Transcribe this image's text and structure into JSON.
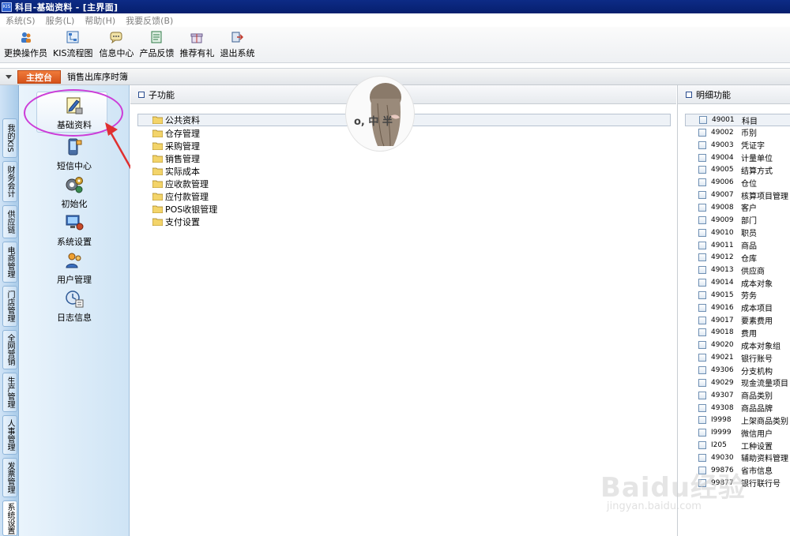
{
  "window": {
    "logo_text": "KIS",
    "title": "科目-基础资料 - [主界面]"
  },
  "menubar": [
    "系统(S)",
    "服务(L)",
    "帮助(H)",
    "我要反馈(B)"
  ],
  "toolbar": [
    "更换操作员",
    "KIS流程图",
    "信息中心",
    "产品反馈",
    "推荐有礼",
    "退出系统"
  ],
  "tabs": {
    "main": "主控台",
    "other": "销售出库序时簿"
  },
  "side_tabs": [
    "我的KIS",
    "财务会计",
    "供应链",
    "电商管理",
    "门店管理",
    "全网营销",
    "生产管理",
    "人事管理",
    "发票管理",
    "系统设置"
  ],
  "modules": [
    "基础资料",
    "短信中心",
    "初始化",
    "系统设置",
    "用户管理",
    "日志信息"
  ],
  "sub_pane": {
    "title": "子功能",
    "items": [
      "公共资料",
      "仓存管理",
      "采购管理",
      "销售管理",
      "实际成本",
      "应收款管理",
      "应付款管理",
      "POS收银管理",
      "支付设置"
    ]
  },
  "detail_pane": {
    "title": "明细功能",
    "items": [
      {
        "code": "49001",
        "name": "科目"
      },
      {
        "code": "49002",
        "name": "币别"
      },
      {
        "code": "49003",
        "name": "凭证字"
      },
      {
        "code": "49004",
        "name": "计量单位"
      },
      {
        "code": "49005",
        "name": "结算方式"
      },
      {
        "code": "49006",
        "name": "仓位"
      },
      {
        "code": "49007",
        "name": "核算项目管理"
      },
      {
        "code": "49008",
        "name": "客户"
      },
      {
        "code": "49009",
        "name": "部门"
      },
      {
        "code": "49010",
        "name": "职员"
      },
      {
        "code": "49011",
        "name": "商品"
      },
      {
        "code": "49012",
        "name": "仓库"
      },
      {
        "code": "49013",
        "name": "供应商"
      },
      {
        "code": "49014",
        "name": "成本对象"
      },
      {
        "code": "49015",
        "name": "劳务"
      },
      {
        "code": "49016",
        "name": "成本项目"
      },
      {
        "code": "49017",
        "name": "要素费用"
      },
      {
        "code": "49018",
        "name": "费用"
      },
      {
        "code": "49020",
        "name": "成本对象组"
      },
      {
        "code": "49021",
        "name": "银行账号"
      },
      {
        "code": "49306",
        "name": "分支机构"
      },
      {
        "code": "49029",
        "name": "现金流量项目"
      },
      {
        "code": "49307",
        "name": "商品类别"
      },
      {
        "code": "49308",
        "name": "商品品牌"
      },
      {
        "code": "I9998",
        "name": "上架商品类别"
      },
      {
        "code": "I9999",
        "name": "微信用户"
      },
      {
        "code": "I205",
        "name": "工种设置"
      },
      {
        "code": "49030",
        "name": "辅助资料管理"
      },
      {
        "code": "99876",
        "name": "省市信息"
      },
      {
        "code": "99877",
        "name": "银行联行号"
      }
    ]
  },
  "watermarks": {
    "avatar_text": "o, 中 半",
    "baidu": "Baidu经验",
    "baidu_url": "jingyan.baidu.com"
  },
  "colors": {
    "title_bar": "#0d2b86",
    "main_tab": "#e0621f",
    "highlight": "#cc3dd8",
    "arrow": "#e03030"
  }
}
